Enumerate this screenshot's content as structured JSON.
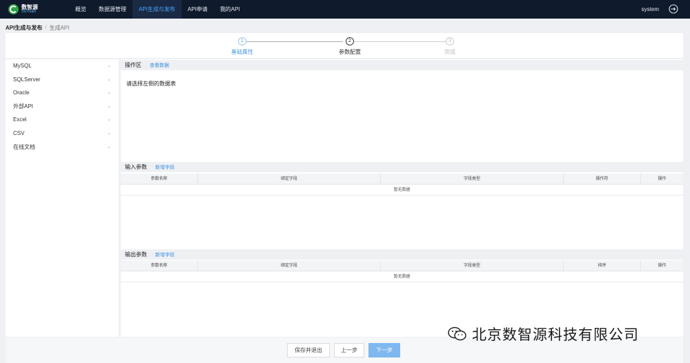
{
  "brand": {
    "cn": "数智源",
    "en": "SoYuan"
  },
  "nav": {
    "items": [
      {
        "label": "概览"
      },
      {
        "label": "数据源管理"
      },
      {
        "label": "API生成与发布"
      },
      {
        "label": "API申请"
      },
      {
        "label": "我的API"
      }
    ],
    "active": "API生成与发布",
    "user": "system"
  },
  "breadcrumb": {
    "parent": "API生成与发布",
    "separator": "/",
    "current": "生成API"
  },
  "steps": [
    {
      "num": "1",
      "label": "基础属性",
      "state": "done"
    },
    {
      "num": "2",
      "label": "参数配置",
      "state": "current"
    },
    {
      "num": "3",
      "label": "完成",
      "state": "pending"
    }
  ],
  "sidebar": {
    "items": [
      {
        "label": "MySQL"
      },
      {
        "label": "SQLServer"
      },
      {
        "label": "Oracle"
      },
      {
        "label": "外部API"
      },
      {
        "label": "Excel"
      },
      {
        "label": "CSV"
      },
      {
        "label": "在线文档"
      }
    ]
  },
  "operation": {
    "title": "操作区",
    "link": "查看数据",
    "placeholder": "请选择左侧的数据表"
  },
  "input_params": {
    "title": "输入参数",
    "add_link": "新增字段",
    "columns": [
      "参数名称",
      "绑定字段",
      "字段类型",
      "操作符",
      "操作"
    ],
    "empty": "暂无数据"
  },
  "output_params": {
    "title": "输出参数",
    "add_link": "新增字段",
    "columns": [
      "参数名称",
      "绑定字段",
      "字段类型",
      "排序",
      "操作"
    ],
    "empty": "暂无数据"
  },
  "footer": {
    "save_exit": "保存并退出",
    "prev": "上一步",
    "next": "下一步"
  },
  "watermark": {
    "text": "北京数智源科技有限公司",
    "icon": "wechat-icon"
  },
  "colors": {
    "nav_bg": "#0f1a2c",
    "accent": "#4aa3ff",
    "primary_button": "#7fb8ee"
  }
}
